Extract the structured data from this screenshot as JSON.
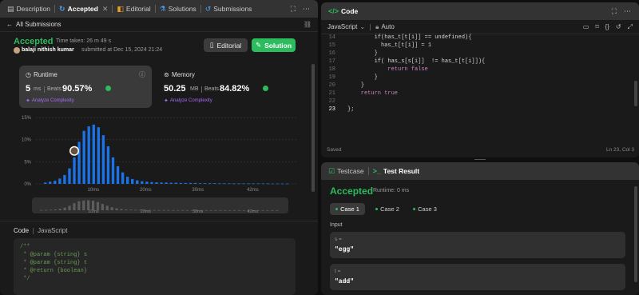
{
  "left": {
    "tabs": [
      {
        "label": "Description",
        "icon": "description-icon"
      },
      {
        "label": "Accepted",
        "icon": "accepted-icon"
      },
      {
        "label": "Editorial",
        "icon": "editorial-icon"
      },
      {
        "label": "Solutions",
        "icon": "solutions-icon"
      },
      {
        "label": "Submissions",
        "icon": "submissions-icon"
      }
    ],
    "back_label": "All Submissions",
    "status": "Accepted",
    "time_taken": "Time taken: 26 m 49 s",
    "user": "balaji nithish kumar",
    "submitted": "submitted at Dec 15, 2024 21:24",
    "editorial_btn": "Editorial",
    "solution_btn": "Solution",
    "runtime": {
      "title": "Runtime",
      "value": "5",
      "unit": "ms",
      "beats_label": "Beats",
      "beats": "90.57%",
      "analyze": "Analyze Complexity"
    },
    "memory": {
      "title": "Memory",
      "value": "50.25",
      "unit": "MB",
      "beats_label": "Beats",
      "beats": "84.82%",
      "analyze": "Analyze Complexity"
    },
    "code_header": {
      "title": "Code",
      "lang": "JavaScript"
    },
    "code_lines": [
      "/**",
      " * @param {string} s",
      " * @param {string} t",
      " * @return {boolean}",
      " */"
    ]
  },
  "chart_data": {
    "type": "bar",
    "ylabel": "",
    "xlabel": "",
    "yticks": [
      "15%",
      "10%",
      "5%",
      "0%"
    ],
    "ylim": [
      0,
      15
    ],
    "xticks": [
      "10ms",
      "20ms",
      "30ms",
      "42ms"
    ],
    "mini_xticks": [
      "10ms",
      "20ms",
      "30ms",
      "42ms"
    ],
    "values": [
      0.3,
      0.5,
      0.7,
      1.2,
      2.0,
      3.5,
      6.0,
      9.5,
      12.0,
      13.0,
      13.4,
      12.8,
      11.0,
      8.5,
      6.0,
      4.0,
      2.6,
      1.6,
      1.1,
      0.8,
      0.6,
      0.5,
      0.4,
      0.35,
      0.3,
      0.3,
      0.25,
      0.25,
      0.2,
      0.2,
      0.2,
      0.2,
      0.15,
      0.15,
      0.15,
      0.15,
      0.12,
      0.12,
      0.12,
      0.1,
      0.1,
      0.1,
      0.1,
      0.1,
      0.1,
      0.1,
      0.1,
      0.08,
      0.08,
      0.08,
      0.08
    ],
    "highlight_index": 6,
    "bar_color": "#1a73e8"
  },
  "right_top": {
    "title": "Code",
    "language": "JavaScript",
    "mode": "Auto",
    "lines": [
      {
        "n": "14",
        "t": "        if(has_t[t[i]] == undefined){"
      },
      {
        "n": "15",
        "t": "          has_t[t[i]] = 1"
      },
      {
        "n": "16",
        "t": "        }"
      },
      {
        "n": "17",
        "t": "        if( has_s[s[i]]  != has_t[t[i]]){"
      },
      {
        "n": "18",
        "t": "            return false"
      },
      {
        "n": "19",
        "t": "        }"
      },
      {
        "n": "20",
        "t": "    }"
      },
      {
        "n": "21",
        "t": "    return true"
      },
      {
        "n": "22",
        "t": ""
      },
      {
        "n": "23",
        "t": "};"
      }
    ],
    "saved": "Saved",
    "cursor": "Ln 23, Col 3"
  },
  "right_bottom": {
    "tabs": [
      "Testcase",
      "Test Result"
    ],
    "status": "Accepted",
    "runtime": "Runtime: 0 ms",
    "cases": [
      "Case 1",
      "Case 2",
      "Case 3"
    ],
    "input_label": "Input",
    "inputs": [
      {
        "name": "s =",
        "value": "\"egg\""
      },
      {
        "name": "t =",
        "value": "\"add\""
      }
    ]
  },
  "colors": {
    "accent_green": "#2cbb5d",
    "bar_blue": "#1a73e8",
    "purple": "#a66bff"
  }
}
